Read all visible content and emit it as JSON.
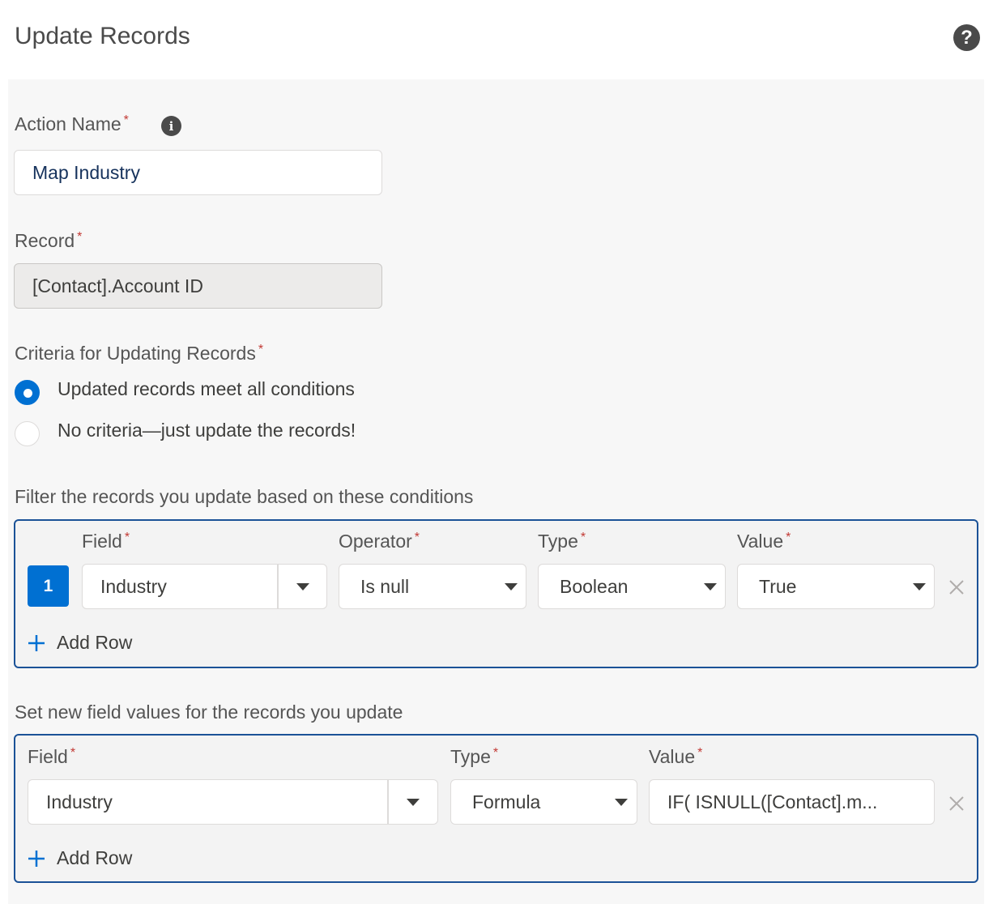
{
  "header": {
    "title": "Update Records",
    "help_icon": "question-circle-icon"
  },
  "required_marker": "*",
  "action_name": {
    "label": "Action Name",
    "value": "Map Industry",
    "info_icon": "info-icon"
  },
  "record": {
    "label": "Record",
    "value": "[Contact].Account ID"
  },
  "criteria": {
    "label": "Criteria for Updating Records",
    "options": [
      {
        "label": "Updated records meet all conditions",
        "selected": true
      },
      {
        "label": "No criteria—just update the records!",
        "selected": false
      }
    ]
  },
  "filter": {
    "heading": "Filter the records you update based on these conditions",
    "columns": {
      "field": "Field",
      "operator": "Operator",
      "type": "Type",
      "value": "Value"
    },
    "rows": [
      {
        "number": "1",
        "field": "Industry",
        "operator": "Is null",
        "type": "Boolean",
        "value": "True"
      }
    ],
    "add_row": "Add Row"
  },
  "set_values": {
    "heading": "Set new field values for the records you update",
    "columns": {
      "field": "Field",
      "type": "Type",
      "value": "Value"
    },
    "rows": [
      {
        "field": "Industry",
        "type": "Formula",
        "value": "IF( ISNULL([Contact].m..."
      }
    ],
    "add_row": "Add Row"
  },
  "colors": {
    "brand": "#0070d2",
    "box_border": "#1b5297",
    "required": "#c23934"
  }
}
